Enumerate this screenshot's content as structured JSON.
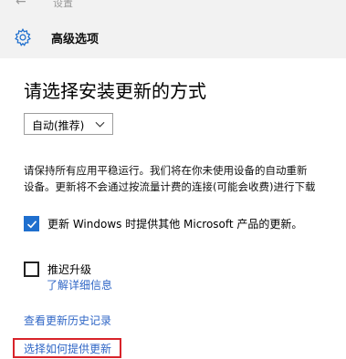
{
  "window": {
    "title": "设置",
    "back_symbol": "←"
  },
  "header": {
    "title": "高级选项",
    "icon": "gear-icon"
  },
  "main": {
    "section_title": "请选择安装更新的方式",
    "install_mode": {
      "selected": "自动(推荐)"
    },
    "description_lines": [
      "请保持所有应用平稳运行。我们将在你未使用设备的自动重新",
      "设备。更新将不会通过按流量计费的连接(可能会收费)进行下载"
    ],
    "options": [
      {
        "label": "更新 Windows 时提供其他 Microsoft 产品的更新。",
        "checked": true
      },
      {
        "label": "推迟升级",
        "checked": false,
        "link": "了解详细信息"
      }
    ],
    "links": {
      "view_history": "查看更新历史记录",
      "choose_delivery": "选择如何提供更新"
    }
  },
  "colors": {
    "accent": "#1f6fce",
    "link": "#2f66c6",
    "highlight": "#d8232a",
    "header_bg": "#f2f2f2"
  }
}
